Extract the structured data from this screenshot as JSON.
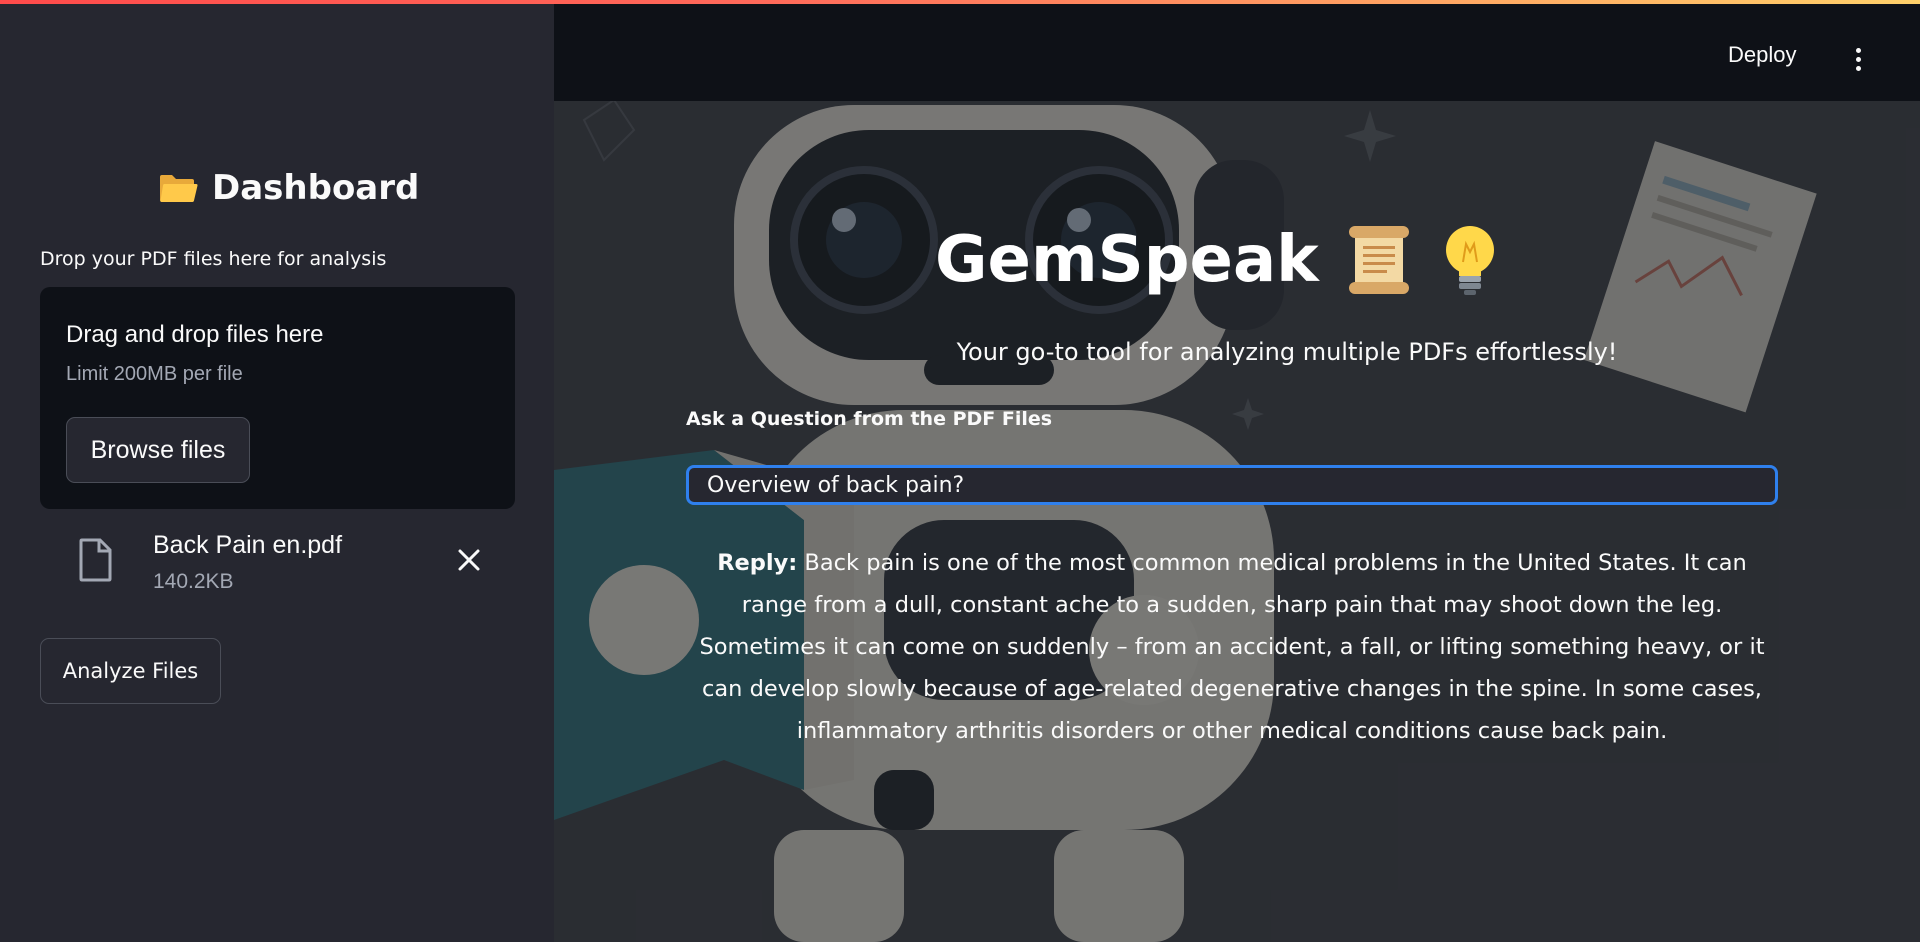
{
  "header": {
    "deploy_label": "Deploy"
  },
  "sidebar": {
    "title": "Dashboard",
    "drop_label": "Drop your PDF files here for analysis",
    "dropzone": {
      "title": "Drag and drop files here",
      "limit": "Limit 200MB per file",
      "browse_label": "Browse files"
    },
    "files": [
      {
        "name": "Back Pain en.pdf",
        "size": "140.2KB"
      }
    ],
    "analyze_label": "Analyze Files"
  },
  "main": {
    "title": "GemSpeak",
    "subtitle": "Your go-to tool for analyzing multiple PDFs effortlessly!",
    "question_label": "Ask a Question from the PDF Files",
    "question_value": "Overview of back pain?",
    "reply_prefix": "Reply:",
    "reply_text": "Back pain is one of the most common medical problems in the United States. It can range from a dull, constant ache to a sudden, sharp pain that may shoot down the leg. Sometimes it can come on suddenly – from an accident, a fall, or lifting something heavy, or it can develop slowly because of age-related degenerative changes in the spine. In some cases, inflammatory arthritis disorders or other medical conditions cause back pain."
  },
  "colors": {
    "accent": "#ff4b4b",
    "input_focus": "#2f80ed",
    "header_bg": "#0e1117",
    "sidebar_bg": "#262730"
  },
  "icons": {
    "title": [
      "scroll-icon",
      "lightbulb-icon"
    ],
    "sidebar_title": "folder-icon",
    "file": "file-icon",
    "remove": "close-icon",
    "menu": "kebab-menu-icon"
  }
}
